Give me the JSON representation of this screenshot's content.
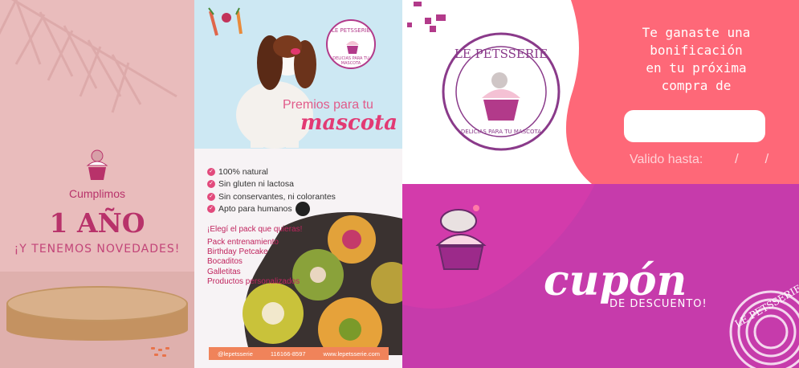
{
  "panel1": {
    "line1": "Cumplimos",
    "line2": "1 AÑO",
    "line3": "¡Y TENEMOS NOVEDADES!"
  },
  "panel2": {
    "badge_title": "LE PETSSERIE",
    "badge_sub": "DELICIAS PARA TU MASCOTA",
    "premios": "Premios para tu",
    "mascota": "mascota",
    "features": [
      "100% natural",
      "Sin gluten ni lactosa",
      "Sin conservantes, ni colorantes",
      "Apto para humanos"
    ],
    "elegi": "¡Elegí el  pack que quieras!",
    "packs": [
      "Pack entrenamiento",
      "Birthday Petcake",
      "Bocaditos",
      "Galletitas",
      "Productos personalizados"
    ],
    "footer": [
      "@lepetsserie",
      "116166-8597",
      "www.lepetsserie.com"
    ]
  },
  "panel3": {
    "seal_title": "LE PETSSERIE",
    "seal_sub": "DELICIAS PARA TU MASCOTA",
    "win_lines": [
      "Te ganaste una",
      "bonificación",
      "en tu próxima",
      "compra de"
    ],
    "valid_label": "Valido hasta:",
    "date_slashes": "/ /"
  },
  "panel4": {
    "cupon": "cupón",
    "desc": "DE DESCUENTO!",
    "watermark": "LE PETSSERIE"
  },
  "colors": {
    "pink_bg": "#e9bcbc",
    "brand_magenta": "#c63bab",
    "coral": "#fe6878",
    "accent_pink": "#e23a74"
  }
}
